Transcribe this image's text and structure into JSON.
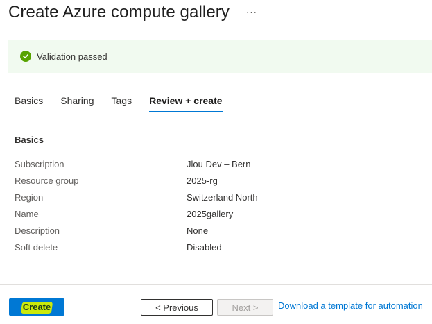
{
  "header": {
    "title": "Create Azure compute gallery",
    "more_label": "···"
  },
  "banner": {
    "icon": "check-circle-icon",
    "text": "Validation passed",
    "color": "#57a300"
  },
  "tabs": [
    {
      "label": "Basics",
      "active": false
    },
    {
      "label": "Sharing",
      "active": false
    },
    {
      "label": "Tags",
      "active": false
    },
    {
      "label": "Review + create",
      "active": true
    }
  ],
  "summary": {
    "section_title": "Basics",
    "rows": [
      {
        "label": "Subscription",
        "value": "Jlou Dev – Bern"
      },
      {
        "label": "Resource group",
        "value": "2025-rg"
      },
      {
        "label": "Region",
        "value": "Switzerland North"
      },
      {
        "label": "Name",
        "value": "2025gallery"
      },
      {
        "label": "Description",
        "value": "None"
      },
      {
        "label": "Soft delete",
        "value": "Disabled"
      }
    ]
  },
  "footer": {
    "create_label": "Create",
    "previous_label": "< Previous",
    "next_label": "Next >",
    "next_disabled": true,
    "template_link": "Download a template for automation"
  },
  "colors": {
    "accent": "#0078d4",
    "success": "#57a300",
    "banner_bg": "#f1faf0",
    "highlight": "#d6f000"
  }
}
